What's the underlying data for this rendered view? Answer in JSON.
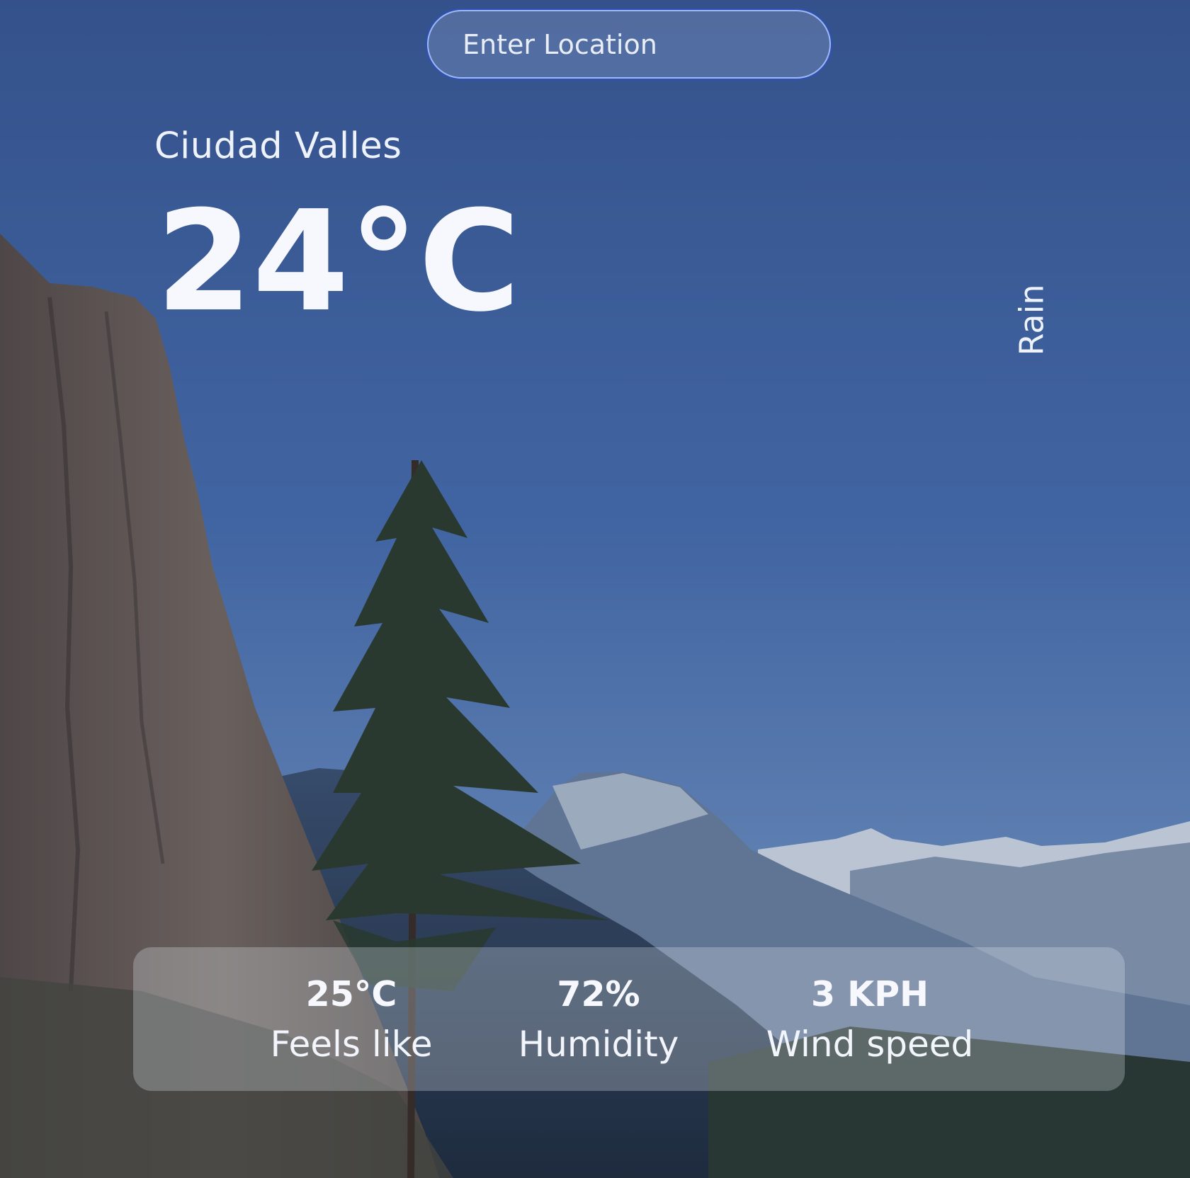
{
  "search": {
    "placeholder": "Enter Location"
  },
  "weather": {
    "city": "Ciudad Valles",
    "temperature": "24°C",
    "condition": "Rain"
  },
  "stats": [
    {
      "value": "25°C",
      "label": "Feels like"
    },
    {
      "value": "72%",
      "label": "Humidity"
    },
    {
      "value": "3 KPH",
      "label": "Wind speed"
    }
  ],
  "background": {
    "scene": "mountain-valley",
    "sky_color": "#3f63a3",
    "cliff_color": "#6b5e55",
    "tree_color": "#2a3a26",
    "snow_color": "#dfe6ef"
  }
}
